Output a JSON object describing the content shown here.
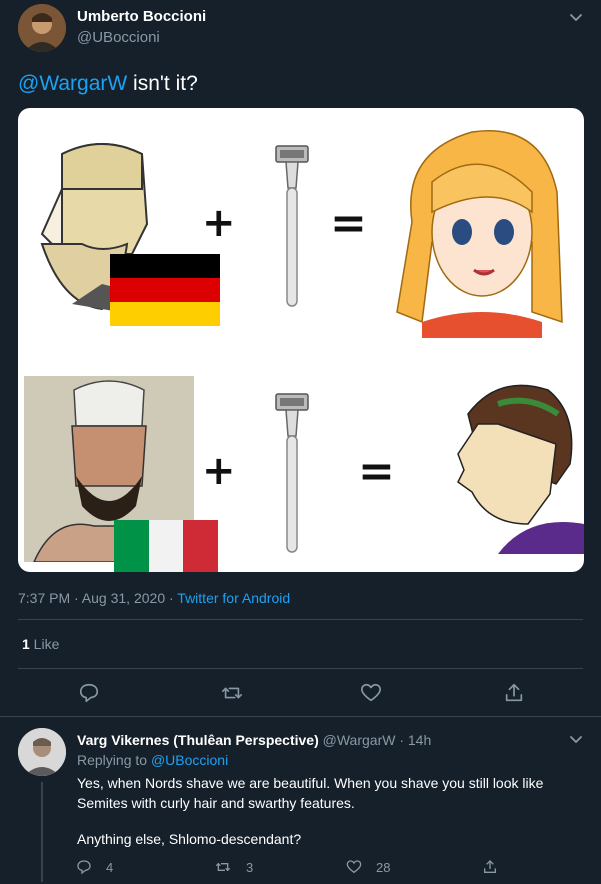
{
  "tweet": {
    "author_name": "Umberto Boccioni",
    "author_handle": "@UBoccioni",
    "text_mention": "@WargarW",
    "text_body": " isn't it?",
    "time": "7:37 PM · Aug 31, 2020 · ",
    "source": "Twitter for Android",
    "likes_count": "1",
    "likes_label": " Like",
    "meme": {
      "plus_1": "+",
      "equals_1": "=",
      "plus_2": "+",
      "equals_2": "="
    }
  },
  "reply": {
    "author_name": "Varg Vikernes (Thulêan Perspective)",
    "author_handle": "@WargarW · 14h",
    "replying_prefix": "Replying to ",
    "replying_handle": "@UBoccioni",
    "text_line1": "Yes, when Nords shave we are beautiful. When you shave you still look like",
    "text_line2": "Semites with curly hair and swarthy features.",
    "text_line3": "Anything else, Shlomo-descendant?",
    "reply_count": "4",
    "retweet_count": "3",
    "like_count": "28"
  },
  "icons": [
    "chevron-down-icon",
    "reply-icon",
    "retweet-icon",
    "like-icon",
    "share-icon",
    "razor-icon"
  ],
  "colors": {
    "background": "#15202b",
    "accent": "#1da1f2",
    "muted": "#8899a6",
    "divider": "#38444d"
  }
}
